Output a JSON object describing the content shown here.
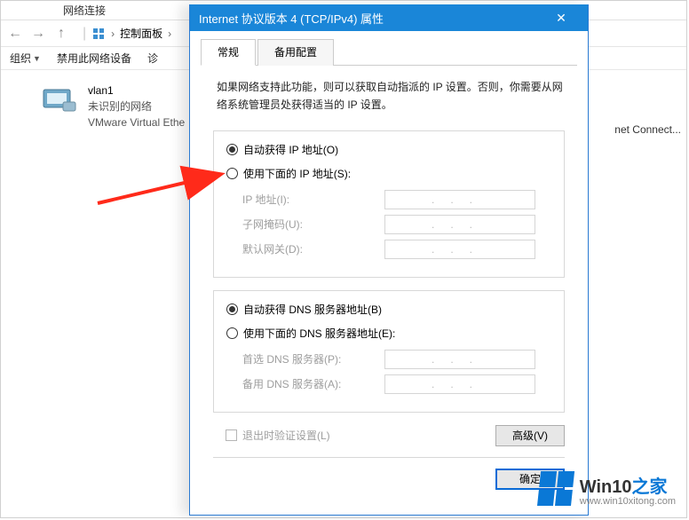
{
  "bg": {
    "title": "网络连接",
    "crumb_ctrl": "控制面板",
    "toolbar": {
      "org": "组织",
      "disable": "禁用此网络设备",
      "diag": "诊"
    },
    "adapter": {
      "name": "vlan1",
      "status": "未识别的网络",
      "desc": "VMware Virtual Ethe"
    },
    "side_label": "net Connect..."
  },
  "dialog": {
    "title": "Internet 协议版本 4 (TCP/IPv4) 属性",
    "tabs": {
      "general": "常规",
      "alt": "备用配置"
    },
    "desc": "如果网络支持此功能，则可以获取自动指派的 IP 设置。否则，你需要从网络系统管理员处获得适当的 IP 设置。",
    "ip": {
      "auto": "自动获得 IP 地址(O)",
      "manual": "使用下面的 IP 地址(S):",
      "addr": "IP 地址(I):",
      "mask": "子网掩码(U):",
      "gw": "默认网关(D):"
    },
    "dns": {
      "auto": "自动获得 DNS 服务器地址(B)",
      "manual": "使用下面的 DNS 服务器地址(E):",
      "pref": "首选 DNS 服务器(P):",
      "alt": "备用 DNS 服务器(A):"
    },
    "validate": "退出时验证设置(L)",
    "advanced": "高级(V)",
    "ok": "确定"
  },
  "watermark": {
    "main": "Win10",
    "suffix": "之家",
    "url": "www.win10xitong.com"
  },
  "dots": "..."
}
